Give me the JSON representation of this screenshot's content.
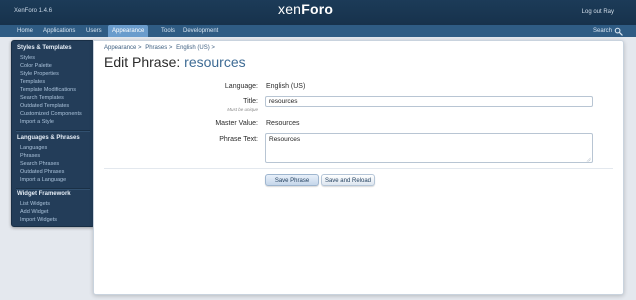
{
  "header": {
    "app_version": "XenForo 1.4.6",
    "logo_light": "xen",
    "logo_bold": "Foro",
    "logout_label": "Log out Ray",
    "brand_color": "#1c3b58",
    "accent_color": "#6a9ccc"
  },
  "nav": {
    "tabs": [
      {
        "label": "Home"
      },
      {
        "label": "Applications"
      },
      {
        "label": "Users"
      },
      {
        "label": "Appearance",
        "active": true
      },
      {
        "label": "Tools"
      },
      {
        "label": "Development"
      }
    ],
    "search_label": "Search",
    "search_icon": "search-icon"
  },
  "sidebar": {
    "sections": [
      {
        "title": "Styles & Templates",
        "items": [
          {
            "label": "Styles"
          },
          {
            "label": "Color Palette"
          },
          {
            "label": "Style Properties"
          },
          {
            "label": "Templates"
          },
          {
            "label": "Template Modifications"
          },
          {
            "label": "Search Templates"
          },
          {
            "label": "Outdated Templates"
          },
          {
            "label": "Customized Components"
          },
          {
            "label": "Import a Style"
          }
        ]
      },
      {
        "title": "Languages & Phrases",
        "items": [
          {
            "label": "Languages"
          },
          {
            "label": "Phrases"
          },
          {
            "label": "Search Phrases"
          },
          {
            "label": "Outdated Phrases"
          },
          {
            "label": "Import a Language"
          }
        ]
      },
      {
        "title": "Widget Framework",
        "items": [
          {
            "label": "List Widgets"
          },
          {
            "label": "Add Widget"
          },
          {
            "label": "Import Widgets"
          }
        ]
      }
    ]
  },
  "breadcrumb": [
    {
      "label": "Appearance >"
    },
    {
      "label": "Phrases >"
    },
    {
      "label": "English (US) >"
    }
  ],
  "page": {
    "title_prefix": "Edit Phrase:",
    "title_phrase": "resources"
  },
  "form": {
    "language_label": "Language:",
    "language_value": "English (US)",
    "title_label": "Title:",
    "title_hint": "Must be unique",
    "title_value": "resources",
    "master_label": "Master Value:",
    "master_value": "Resources",
    "phrase_text_label": "Phrase Text:",
    "phrase_text_value": "Resources",
    "save_button": "Save Phrase",
    "save_reload_button": "Save and Reload"
  }
}
